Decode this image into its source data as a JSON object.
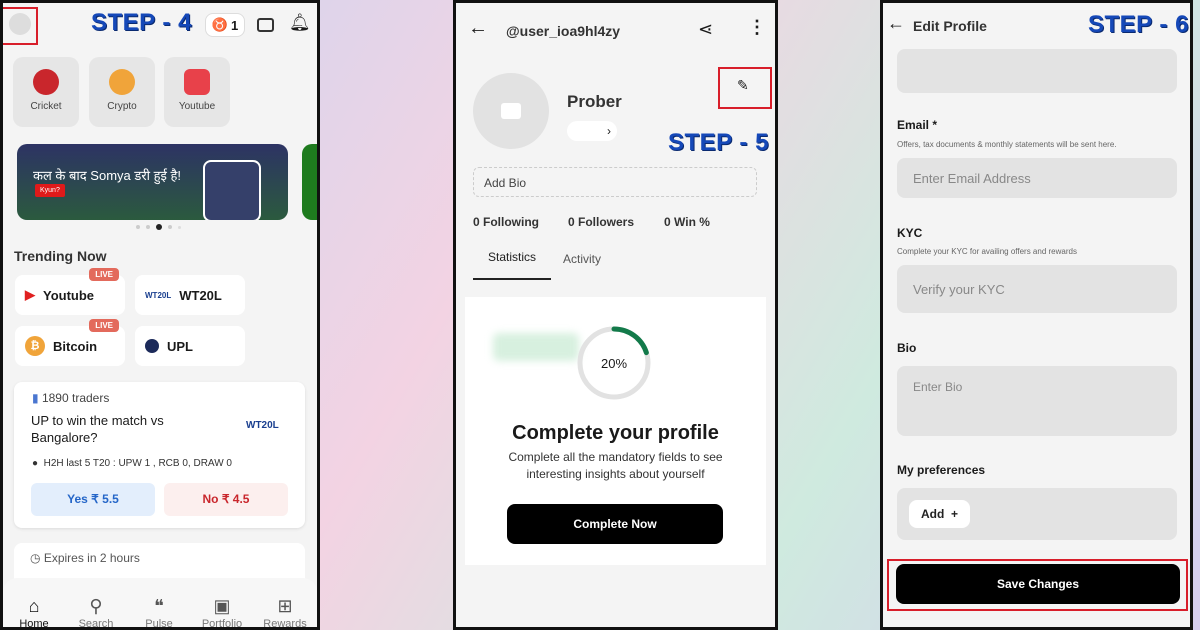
{
  "steps": {
    "s4": "STEP - 4",
    "s5": "STEP - 5",
    "s6": "STEP - 6"
  },
  "home": {
    "streak_count": "1",
    "categories": [
      {
        "label": "Cricket",
        "icon": "cricket-ball-icon",
        "color": "#c9262c"
      },
      {
        "label": "Crypto",
        "icon": "crypto-coin-icon",
        "color": "#f0a43a"
      },
      {
        "label": "Youtube",
        "icon": "youtube-icon",
        "color": "#e8414a"
      }
    ],
    "banner": {
      "text": "कल के बाद Somya डरी हुई है!",
      "button": "Kyun?"
    },
    "trending_title": "Trending Now",
    "trending": [
      {
        "label": "Youtube",
        "badge": "LIVE",
        "icon": "youtube-play-icon"
      },
      {
        "label": "WT20L",
        "badge": "",
        "icon": "wt20l-logo-icon"
      },
      {
        "label": "Bitcoin",
        "badge": "LIVE",
        "icon": "bitcoin-icon"
      },
      {
        "label": "UPL",
        "badge": "",
        "icon": "upl-logo-icon"
      }
    ],
    "card": {
      "traders": "1890 traders",
      "question": "UP to win the match vs Bangalore?",
      "logo": "WT20L",
      "info": "H2H last 5 T20 : UPW 1 ,  RCB 0, DRAW 0",
      "yes": "Yes ₹ 5.5",
      "no": "No ₹ 4.5"
    },
    "card2": {
      "expires": "Expires in 2 hours"
    },
    "nav": [
      {
        "label": "Home",
        "icon": "home-icon"
      },
      {
        "label": "Search",
        "icon": "search-icon"
      },
      {
        "label": "Pulse",
        "icon": "pulse-icon"
      },
      {
        "label": "Portfolio",
        "icon": "portfolio-icon"
      },
      {
        "label": "Rewards",
        "icon": "gift-icon"
      }
    ]
  },
  "profile": {
    "username": "@user_ioa9hl4zy",
    "name": "Prober",
    "bio_placeholder": "Add Bio",
    "stats": [
      "0 Following",
      "0 Followers",
      "0 Win %"
    ],
    "tabs": [
      "Statistics",
      "Activity"
    ],
    "progress_percent": 20,
    "progress_label": "20%",
    "accent": "#137a4a",
    "title": "Complete your profile",
    "desc": "Complete all the mandatory fields to see interesting insights about yourself",
    "cta": "Complete Now"
  },
  "edit": {
    "title": "Edit Profile",
    "email_label": "Email *",
    "email_sub": "Offers, tax documents & monthly statements will be sent here.",
    "email_placeholder": "Enter Email Address",
    "kyc_label": "KYC",
    "kyc_sub": "Complete your KYC for availing offers and rewards",
    "kyc_placeholder": "Verify your KYC",
    "bio_label": "Bio",
    "bio_placeholder": "Enter Bio",
    "pref_label": "My preferences",
    "add": "Add",
    "add_icon": "+",
    "save": "Save Changes"
  }
}
